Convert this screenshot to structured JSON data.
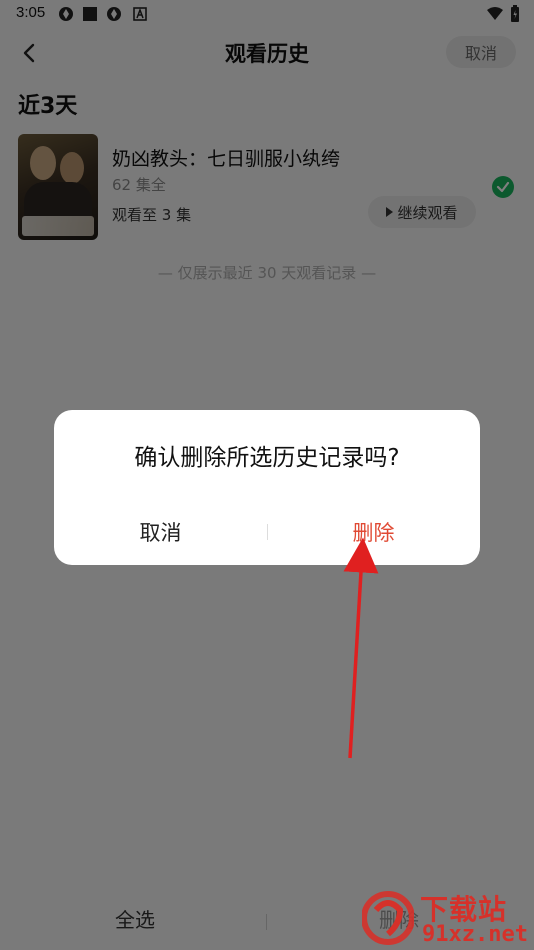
{
  "status_bar": {
    "time": "3:05"
  },
  "header": {
    "title": "观看历史",
    "cancel_label": "取消"
  },
  "section": {
    "heading": "近3天"
  },
  "history_item": {
    "title": "奶凶教头：七日驯服小纨绔",
    "episodes": "62 集全",
    "progress": "观看至 3 集",
    "continue_label": "继续观看",
    "selected": true
  },
  "footnote": "— 仅展示最近 30 天观看记录 —",
  "bottom_bar": {
    "select_all_label": "全选",
    "delete_label": "删除"
  },
  "dialog": {
    "message": "确认删除所选历史记录吗?",
    "cancel_label": "取消",
    "delete_label": "删除"
  },
  "watermark": {
    "title": "下载站",
    "site": "91xz.net"
  },
  "colors": {
    "accent_red": "#e04a34",
    "check_green": "#18b25c",
    "annotation_red": "#e02020"
  }
}
